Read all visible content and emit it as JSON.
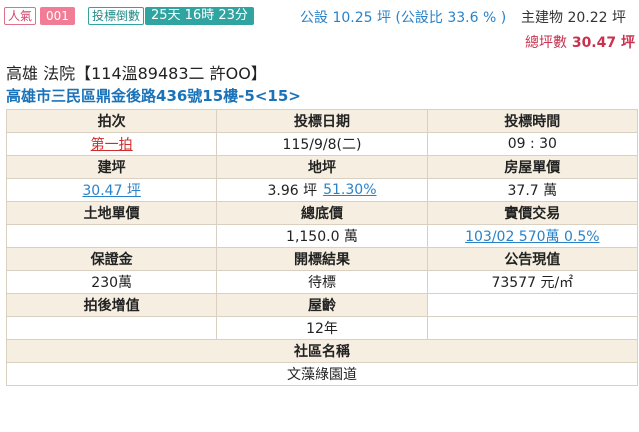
{
  "badges": {
    "popularity_label": "人氣",
    "popularity_value": "001",
    "countdown_label": "投標倒數",
    "countdown_value": "25天 16時 23分"
  },
  "area": {
    "public_area": "公設 10.25 坪 (公設比 33.6 % )",
    "main_building": "主建物 20.22 坪",
    "total_label": "總坪數",
    "total_value": "30.47 坪"
  },
  "case": {
    "title": "高雄 法院【114溫89483二 許OO】",
    "address": "高雄市三民區鼎金後路436號15樓-5<15>"
  },
  "table": {
    "auction_round_label": "拍次",
    "auction_round_value": "第一拍",
    "bid_date_label": "投標日期",
    "bid_date_value": "115/9/8(二)",
    "bid_time_label": "投標時間",
    "bid_time_value": "09 : 30",
    "building_area_label": "建坪",
    "building_area_value": "30.47 坪",
    "land_area_label": "地坪",
    "land_area_value": "3.96 坪",
    "land_area_pct": "51.30%",
    "house_unit_price_label": "房屋單價",
    "house_unit_price_value": "37.7 萬",
    "land_unit_price_label": "土地單價",
    "land_unit_price_value": "",
    "reserve_price_label": "總底價",
    "reserve_price_value": "1,150.0 萬",
    "actual_transaction_label": "實價交易",
    "actual_transaction_value": "103/02 570萬 0.5%",
    "deposit_label": "保證金",
    "deposit_value": "230萬",
    "result_label": "開標結果",
    "result_value": "待標",
    "announced_value_label": "公告現值",
    "announced_value_value": "73577 元/㎡",
    "post_auction_label": "拍後增值",
    "post_auction_value": "",
    "building_age_label": "屋齡",
    "building_age_value": "12年",
    "community_label": "社區名稱",
    "community_value": "文藻綠園道"
  }
}
